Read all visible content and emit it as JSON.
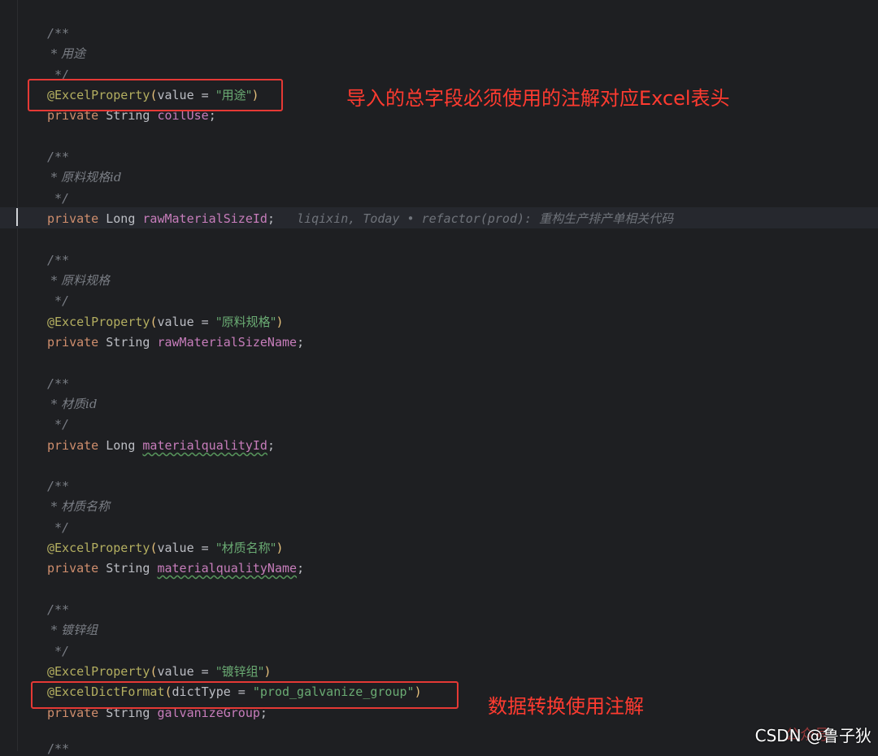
{
  "editor": {
    "blocks": [
      {
        "open": "/**",
        "comment": " * 用途",
        "close": " */",
        "annotation": "@ExcelProperty",
        "ann_open": "(",
        "ann_key": "value = ",
        "ann_val": "\"用途\"",
        "ann_close": ")",
        "decl_kw": "private",
        "decl_type": "String",
        "decl_name": "coilUse",
        "decl_end": ";"
      },
      {
        "open": "/**",
        "comment": " * 原料规格id",
        "close": " */",
        "decl_kw": "private",
        "decl_type": "Long",
        "decl_name": "rawMaterialSizeId",
        "decl_end": ";",
        "blame": "liqixin, Today • refactor(prod): 重构生产排产单相关代码"
      },
      {
        "open": "/**",
        "comment": " * 原料规格",
        "close": " */",
        "annotation": "@ExcelProperty",
        "ann_open": "(",
        "ann_key": "value = ",
        "ann_val": "\"原料规格\"",
        "ann_close": ")",
        "decl_kw": "private",
        "decl_type": "String",
        "decl_name": "rawMaterialSizeName",
        "decl_end": ";"
      },
      {
        "open": "/**",
        "comment": " * 材质id",
        "close": " */",
        "decl_kw": "private",
        "decl_type": "Long",
        "decl_name": "materialqualityId",
        "decl_end": ";"
      },
      {
        "open": "/**",
        "comment": " * 材质名称",
        "close": " */",
        "annotation": "@ExcelProperty",
        "ann_open": "(",
        "ann_key": "value = ",
        "ann_val": "\"材质名称\"",
        "ann_close": ")",
        "decl_kw": "private",
        "decl_type": "String",
        "decl_name": "materialqualityName",
        "decl_end": ";"
      },
      {
        "open": "/**",
        "comment": " * 镀锌组",
        "close": " */",
        "annotation": "@ExcelProperty",
        "ann_open": "(",
        "ann_key": "value = ",
        "ann_val": "\"镀锌组\"",
        "ann_close": ")",
        "annotation2": "@ExcelDictFormat",
        "ann2_open": "(",
        "ann2_key": "dictType = ",
        "ann2_val": "\"prod_galvanize_group\"",
        "ann2_close": ")",
        "decl_kw": "private",
        "decl_type": "String",
        "decl_name": "galvanizeGroup",
        "decl_end": ";"
      }
    ],
    "trailing": "/**"
  },
  "notes": {
    "excel_header": "导入的总字段必须使用的注解对应Excel表头",
    "dict_convert": "数据转换使用注解"
  },
  "watermark": {
    "text": "CSDN @鲁子狄",
    "faint": "公众号"
  },
  "colors": {
    "background": "#1e1f22",
    "keyword": "#cf8e6d",
    "field": "#c77dbb",
    "annotation": "#b3ae60",
    "string": "#6aab73",
    "comment": "#7a7e85",
    "highlight_box": "#e53935"
  }
}
